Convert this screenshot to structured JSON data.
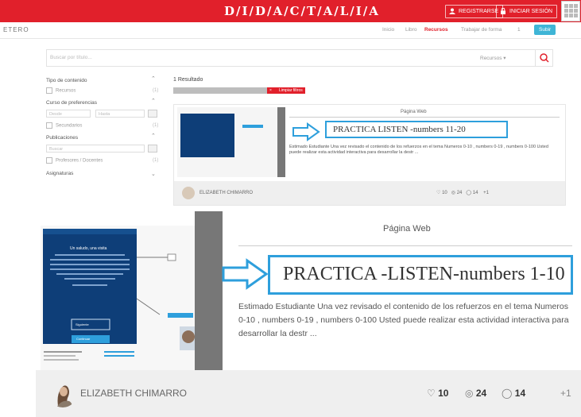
{
  "brand": {
    "name": "D/I/D/A/C/T/A/L/I/A"
  },
  "top_actions": {
    "register": "REGISTRARSE",
    "login": "INICIAR SESIÓN"
  },
  "subnav": {
    "logo": "ETERO",
    "links": [
      "Inicio",
      "Libro",
      "Recursos",
      "Trabajar de forma"
    ],
    "active_link": "Recursos",
    "count": "1",
    "button": "Subir"
  },
  "search": {
    "placeholder": "Buscar por título...",
    "scope": "Recursos"
  },
  "filters": {
    "content_type": "Tipo de contenido",
    "resources": "Recursos",
    "grade_label": "Curso de preferencias",
    "grade_from": "Desde",
    "grade_to": "Hasta",
    "reading": "Secundarios",
    "by_author": "Publicaciones",
    "author_ph": "Buscar",
    "teacher": "Profesores / Docentes",
    "subjects": "Asignaturas"
  },
  "results": {
    "count_label": "1 Resultado",
    "chip_clear": "Limpiar filtros"
  },
  "card": {
    "kind": "Página Web",
    "title_small": "PRACTICA LISTEN -numbers 11-20",
    "title": "PRACTICA -LISTEN-numbers 1-10",
    "description": "Estimado Estudiante Una vez revisado el contenido de los refuerzos en el tema Numeros 0-10 , numbers 0-19 , numbers 0-100 Usted puede realizar esta actividad interactiva para desarrollar la destr ...",
    "author": "ELIZABETH CHIMARRO",
    "likes": "10",
    "views": "24",
    "comments": "14",
    "more": "+1",
    "popup_title": "Un saludo, una visita",
    "popup_button": "Siguiente",
    "popup_button2": "Continuar"
  },
  "colors": {
    "brand_red": "#e1202b",
    "accent_blue": "#2e9fdc",
    "popup_navy": "#0e3e78"
  }
}
